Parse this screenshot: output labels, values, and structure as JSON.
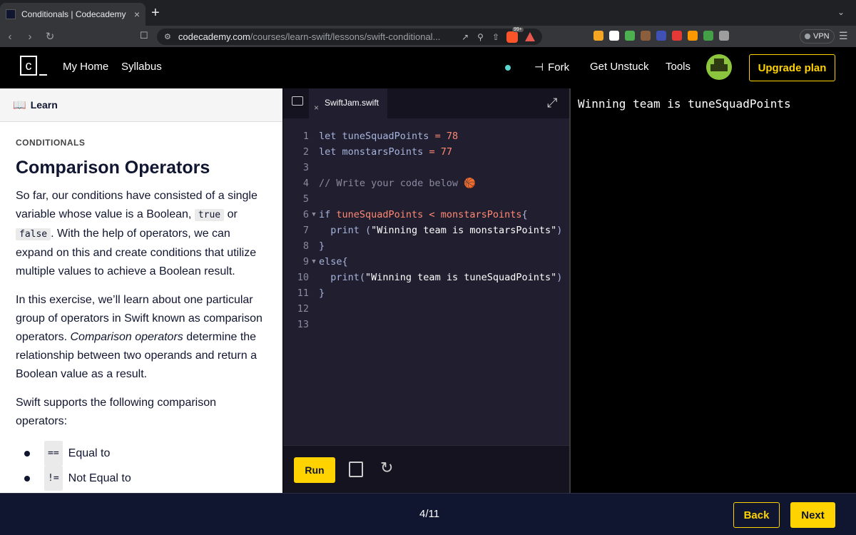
{
  "browser": {
    "tab_title": "Conditionals | Codecademy",
    "tab_close": "×",
    "new_tab": "+",
    "url_host": "codecademy.com",
    "url_path": "/courses/learn-swift/lessons/swift-conditional...",
    "brave_badge": "99+",
    "vpn_label": "VPN",
    "extension_colors": [
      "#f5a623",
      "#ffffff",
      "#4caf50",
      "#8b5e3c",
      "#3f51b5",
      "#e53935",
      "#ff9800",
      "#43a047",
      "#9e9e9e"
    ]
  },
  "header": {
    "logo_char": "c",
    "nav": {
      "home": "My Home",
      "syllabus": "Syllabus"
    },
    "fork": "Fork",
    "get_unstuck": "Get Unstuck",
    "tools": "Tools",
    "upgrade": "Upgrade plan",
    "status_color": "#5cd5cf",
    "accent": "#ffd300"
  },
  "learn": {
    "header_title": "Learn",
    "kicker": "CONDITIONALS",
    "title": "Comparison Operators",
    "p1_a": "So far, our conditions have consisted of a single variable whose value is a Boolean, ",
    "p1_code1": "true",
    "p1_b": " or ",
    "p1_code2": "false",
    "p1_c": ". With the help of operators, we can expand on this and create conditions that utilize multiple values to achieve a Boolean result.",
    "p2_a": "In this exercise, we’ll learn about one particular group of operators in Swift known as comparison operators. ",
    "p2_em": "Comparison operators",
    "p2_b": " determine the relationship between two operands and return a Boolean value as a result.",
    "p3": "Swift supports the following comparison operators:",
    "operators": [
      {
        "code": "==",
        "label": "Equal to"
      },
      {
        "code": "!=",
        "label": "Not Equal to"
      }
    ]
  },
  "editor": {
    "file_name": "SwiftJam.swift",
    "run": "Run",
    "lines": [
      {
        "n": "1",
        "parts": [
          [
            "kw",
            "let tuneSquadPoints "
          ],
          [
            "op",
            "="
          ],
          [
            "num",
            " 78"
          ]
        ]
      },
      {
        "n": "2",
        "parts": [
          [
            "kw",
            "let monstarsPoints "
          ],
          [
            "op",
            "="
          ],
          [
            "num",
            " 77"
          ]
        ]
      },
      {
        "n": "3",
        "parts": []
      },
      {
        "n": "4",
        "parts": [
          [
            "cm",
            "// Write your code below 🏀"
          ]
        ]
      },
      {
        "n": "5",
        "parts": []
      },
      {
        "n": "6",
        "fold": true,
        "parts": [
          [
            "kw",
            "if "
          ],
          [
            "op",
            "tuneSquadPoints < monstarsPoints"
          ],
          [
            "kw",
            "{"
          ]
        ]
      },
      {
        "n": "7",
        "parts": [
          [
            "kw",
            "  print ("
          ],
          [
            "str",
            "\"Winning team is monstarsPoints\""
          ],
          [
            "kw",
            ")"
          ]
        ]
      },
      {
        "n": "8",
        "parts": [
          [
            "kw",
            "}"
          ]
        ]
      },
      {
        "n": "9",
        "fold": true,
        "parts": [
          [
            "kw",
            "else{"
          ]
        ]
      },
      {
        "n": "10",
        "parts": [
          [
            "kw",
            "  print("
          ],
          [
            "str",
            "\"Winning team is tuneSquadPoints\""
          ],
          [
            "kw",
            ")"
          ]
        ]
      },
      {
        "n": "11",
        "parts": [
          [
            "kw",
            "}"
          ]
        ]
      },
      {
        "n": "12",
        "parts": []
      },
      {
        "n": "13",
        "parts": []
      }
    ]
  },
  "output": {
    "text": "Winning team is tuneSquadPoints"
  },
  "footer": {
    "progress": "4/11",
    "back": "Back",
    "next": "Next"
  }
}
